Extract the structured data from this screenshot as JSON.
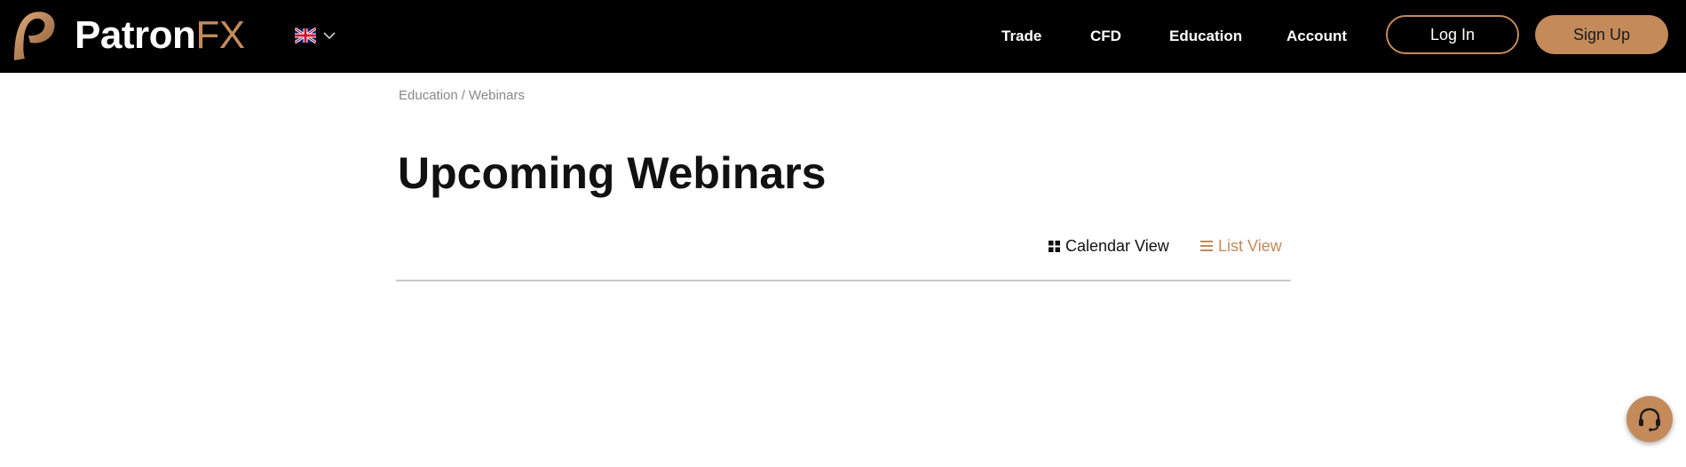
{
  "brand": {
    "name_primary": "Patron",
    "name_accent": "FX",
    "accent_color": "#c48a5a",
    "header_bg": "#000000"
  },
  "language": {
    "selected": "English (UK)",
    "icon": "uk-flag-icon"
  },
  "nav": {
    "items": [
      {
        "label": "Trade"
      },
      {
        "label": "CFD"
      },
      {
        "label": "Education"
      },
      {
        "label": "Account"
      }
    ]
  },
  "auth": {
    "login_label": "Log In",
    "signup_label": "Sign Up"
  },
  "breadcrumb": {
    "items": [
      "Education",
      "Webinars"
    ],
    "separator": "/"
  },
  "page": {
    "title": "Upcoming Webinars"
  },
  "view_toggle": {
    "calendar_label": "Calendar View",
    "list_label": "List View",
    "active": "list"
  },
  "support": {
    "icon": "headset-icon"
  }
}
